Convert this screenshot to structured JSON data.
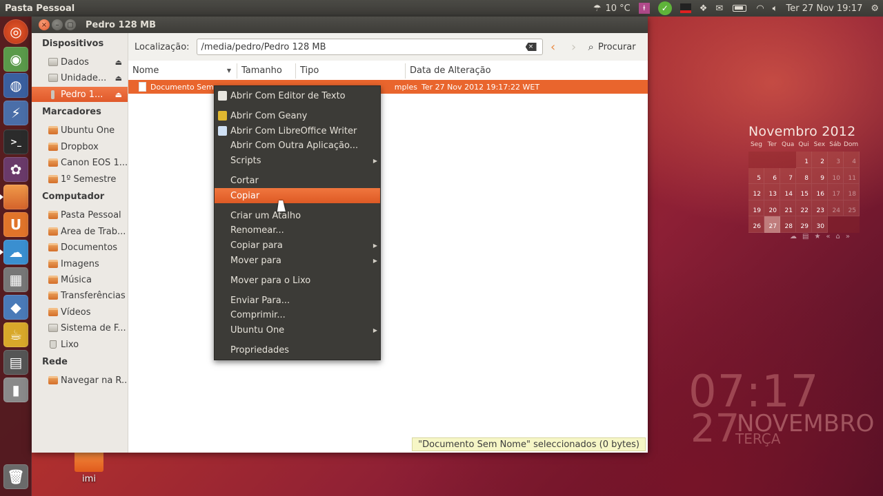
{
  "top_panel": {
    "app_title": "Pasta Pessoal",
    "temperature": "10 °C",
    "datetime": "Ter 27 Nov 19:17"
  },
  "window": {
    "title": "Pedro 128 MB",
    "location_label": "Localização:",
    "location_path": "/media/pedro/Pedro 128 MB",
    "search_label": "Procurar"
  },
  "sidebar": {
    "devices_heading": "Dispositivos",
    "devices": [
      {
        "label": "Dados"
      },
      {
        "label": "Unidade..."
      },
      {
        "label": "Pedro 1..."
      }
    ],
    "bookmarks_heading": "Marcadores",
    "bookmarks": [
      {
        "label": "Ubuntu One"
      },
      {
        "label": "Dropbox"
      },
      {
        "label": "Canon EOS 1..."
      },
      {
        "label": "1º Semestre"
      }
    ],
    "computer_heading": "Computador",
    "computer": [
      {
        "label": "Pasta Pessoal"
      },
      {
        "label": "Área de Trab..."
      },
      {
        "label": "Documentos"
      },
      {
        "label": "Imagens"
      },
      {
        "label": "Música"
      },
      {
        "label": "Transferências"
      },
      {
        "label": "Vídeos"
      },
      {
        "label": "Sistema de F..."
      },
      {
        "label": "Lixo"
      }
    ],
    "network_heading": "Rede",
    "network": [
      {
        "label": "Navegar na R..."
      }
    ]
  },
  "file_list": {
    "columns": [
      "Nome",
      "Tamanho",
      "Tipo",
      "Data de Alteração"
    ],
    "selected_file": {
      "name_visible": "Documento Sem",
      "type_fragment": "mples",
      "modified": "Ter 27 Nov 2012 19:17:22 WET"
    },
    "status": "\"Documento Sem Nome\" seleccionados (0 bytes)"
  },
  "context_menu": {
    "items": [
      {
        "label": "Abrir Com Editor de Texto"
      },
      {
        "label": "Abrir Com Geany"
      },
      {
        "label": "Abrir Com LibreOffice Writer"
      },
      {
        "label": "Abrir Com Outra Aplicação..."
      },
      {
        "label": "Scripts"
      },
      {
        "label": "Cortar"
      },
      {
        "label": "Copiar"
      },
      {
        "label": "Criar um Atalho"
      },
      {
        "label": "Renomear..."
      },
      {
        "label": "Copiar para"
      },
      {
        "label": "Mover para"
      },
      {
        "label": "Mover para o Lixo"
      },
      {
        "label": "Enviar Para..."
      },
      {
        "label": "Comprimir..."
      },
      {
        "label": "Ubuntu One"
      },
      {
        "label": "Propriedades"
      }
    ],
    "highlighted": "Copiar"
  },
  "calendar": {
    "title": "Novembro 2012",
    "weekdays": [
      "Seg",
      "Ter",
      "Qua",
      "Qui",
      "Sex",
      "Sáb",
      "Dom"
    ],
    "weeks": [
      [
        "",
        "",
        "",
        "1",
        "2",
        "3",
        "4"
      ],
      [
        "5",
        "6",
        "7",
        "8",
        "9",
        "10",
        "11"
      ],
      [
        "12",
        "13",
        "14",
        "15",
        "16",
        "17",
        "18"
      ],
      [
        "19",
        "20",
        "21",
        "22",
        "23",
        "24",
        "25"
      ],
      [
        "26",
        "27",
        "28",
        "29",
        "30",
        "",
        ""
      ]
    ],
    "today": "27"
  },
  "clock": {
    "time": "07:17",
    "day": "27",
    "month": "NOVEMBRO",
    "weekday": "TERÇA"
  },
  "desktop": {
    "icon_label": "imi"
  },
  "colors": {
    "accent": "#e9652d",
    "menu_bg": "#3c3b37",
    "panel_bg": "#3b3a36"
  }
}
